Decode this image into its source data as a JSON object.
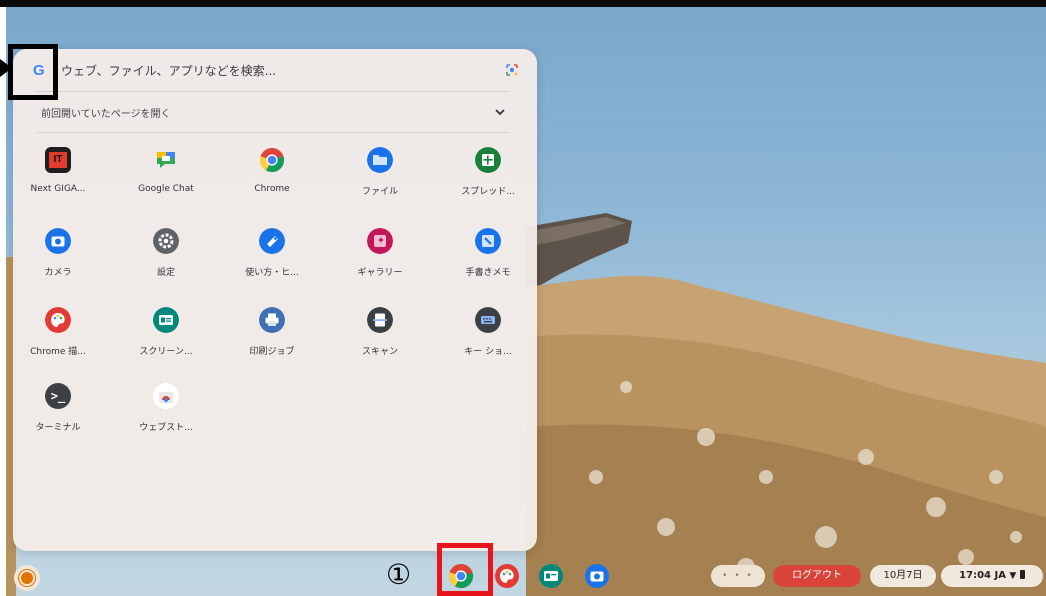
{
  "launcher": {
    "search_placeholder": "ウェブ、ファイル、アプリなどを検索...",
    "google_logo": "G",
    "recent_label": "前回開いていたページを開く",
    "apps": [
      {
        "label": "Next GIGA...",
        "icon": "next-giga-icon",
        "color": "#e33a2c",
        "glyph": "IT"
      },
      {
        "label": "Google Chat",
        "icon": "google-chat-icon",
        "color": "#34a853",
        "glyph": ""
      },
      {
        "label": "Chrome",
        "icon": "chrome-icon",
        "color": "#4285f4",
        "glyph": ""
      },
      {
        "label": "ファイル",
        "icon": "files-icon",
        "color": "#1a73e8",
        "glyph": ""
      },
      {
        "label": "スプレッド...",
        "icon": "sheets-icon",
        "color": "#188038",
        "glyph": "+"
      },
      {
        "label": "カメラ",
        "icon": "camera-icon",
        "color": "#1a73e8",
        "glyph": ""
      },
      {
        "label": "設定",
        "icon": "settings-icon",
        "color": "#5f6368",
        "glyph": "⚙"
      },
      {
        "label": "使い方・ヒ...",
        "icon": "explore-icon",
        "color": "#1a73e8",
        "glyph": ""
      },
      {
        "label": "ギャラリー",
        "icon": "gallery-icon",
        "color": "#c2185b",
        "glyph": ""
      },
      {
        "label": "手書きメモ",
        "icon": "cursive-icon",
        "color": "#1a73e8",
        "glyph": ""
      },
      {
        "label": "Chrome 描...",
        "icon": "chrome-canvas-icon",
        "color": "#e53935",
        "glyph": ""
      },
      {
        "label": "スクリーン...",
        "icon": "screencast-icon",
        "color": "#00897b",
        "glyph": ""
      },
      {
        "label": "印刷ジョブ",
        "icon": "print-jobs-icon",
        "color": "#3c6fb5",
        "glyph": ""
      },
      {
        "label": "スキャン",
        "icon": "scan-icon",
        "color": "#3c4043",
        "glyph": ""
      },
      {
        "label": "キー ショ...",
        "icon": "shortcuts-icon",
        "color": "#3c4043",
        "glyph": ""
      },
      {
        "label": "ターミナル",
        "icon": "terminal-icon",
        "color": "#3c4043",
        "glyph": ">_"
      },
      {
        "label": "ウェブスト...",
        "icon": "web-store-icon",
        "color": "#ffffff",
        "glyph": ""
      }
    ]
  },
  "annotation": {
    "step": "①"
  },
  "shelf": {
    "logout_label": "ログアウト",
    "date": "10月7日",
    "time_status": "17:04 JA"
  }
}
